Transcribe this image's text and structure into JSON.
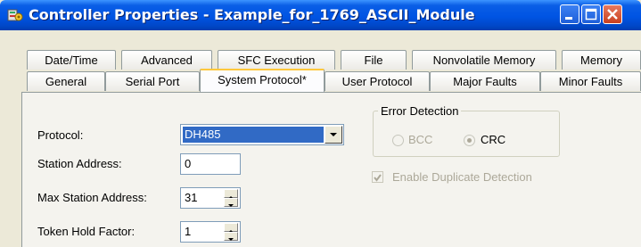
{
  "window": {
    "title": "Controller Properties - Example_for_1769_ASCII_Module",
    "app_icon": "controller-properties-icon",
    "buttons": [
      "minimize-icon",
      "maximize-icon",
      "close-icon"
    ]
  },
  "tabs": {
    "row1": [
      "Date/Time",
      "Advanced",
      "SFC Execution",
      "File",
      "Nonvolatile Memory",
      "Memory"
    ],
    "row2": [
      "General",
      "Serial Port",
      "System Protocol*",
      "User Protocol",
      "Major Faults",
      "Minor Faults"
    ],
    "active": "System Protocol*"
  },
  "form": {
    "protocol_label": "Protocol:",
    "protocol_value": "DH485",
    "station_address_label": "Station Address:",
    "station_address_value": "0",
    "max_station_address_label": "Max Station Address:",
    "max_station_address_value": "31",
    "token_hold_factor_label": "Token Hold Factor:",
    "token_hold_factor_value": "1"
  },
  "error_detection": {
    "title": "Error Detection",
    "options": [
      "BCC",
      "CRC"
    ],
    "selected": "CRC",
    "duplicate_label": "Enable Duplicate Detection",
    "duplicate_checked": true
  },
  "colors": {
    "title_bar": "#0054E3",
    "selection": "#316AC5",
    "active_tab_accent": "#FFC83C",
    "disabled_text": "#ACA899"
  }
}
